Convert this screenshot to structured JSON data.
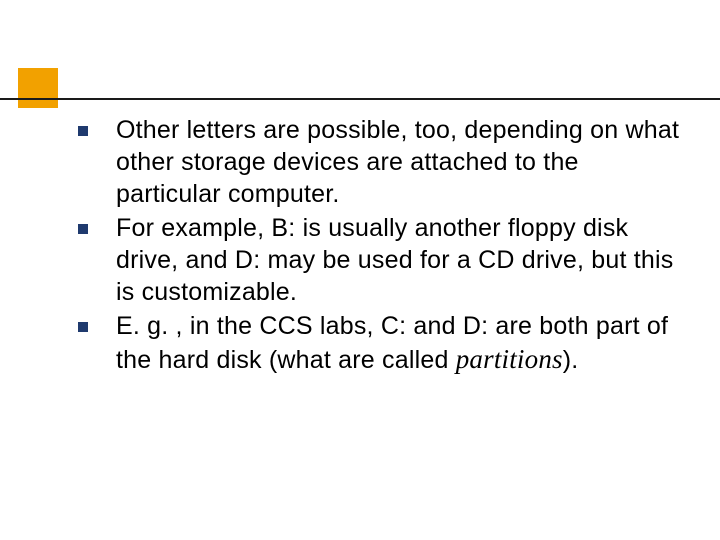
{
  "bullets": [
    {
      "text": "Other letters are possible, too, depending on what other storage devices are attached to the particular computer."
    },
    {
      "text": "For example, B: is usually another floppy disk drive, and D: may be used for a CD drive, but this is customizable."
    },
    {
      "text_prefix": "E. g. , in the CCS labs, C: and D: are both part of the hard disk (what are called ",
      "italic": "partitions",
      "text_suffix": ")."
    }
  ]
}
